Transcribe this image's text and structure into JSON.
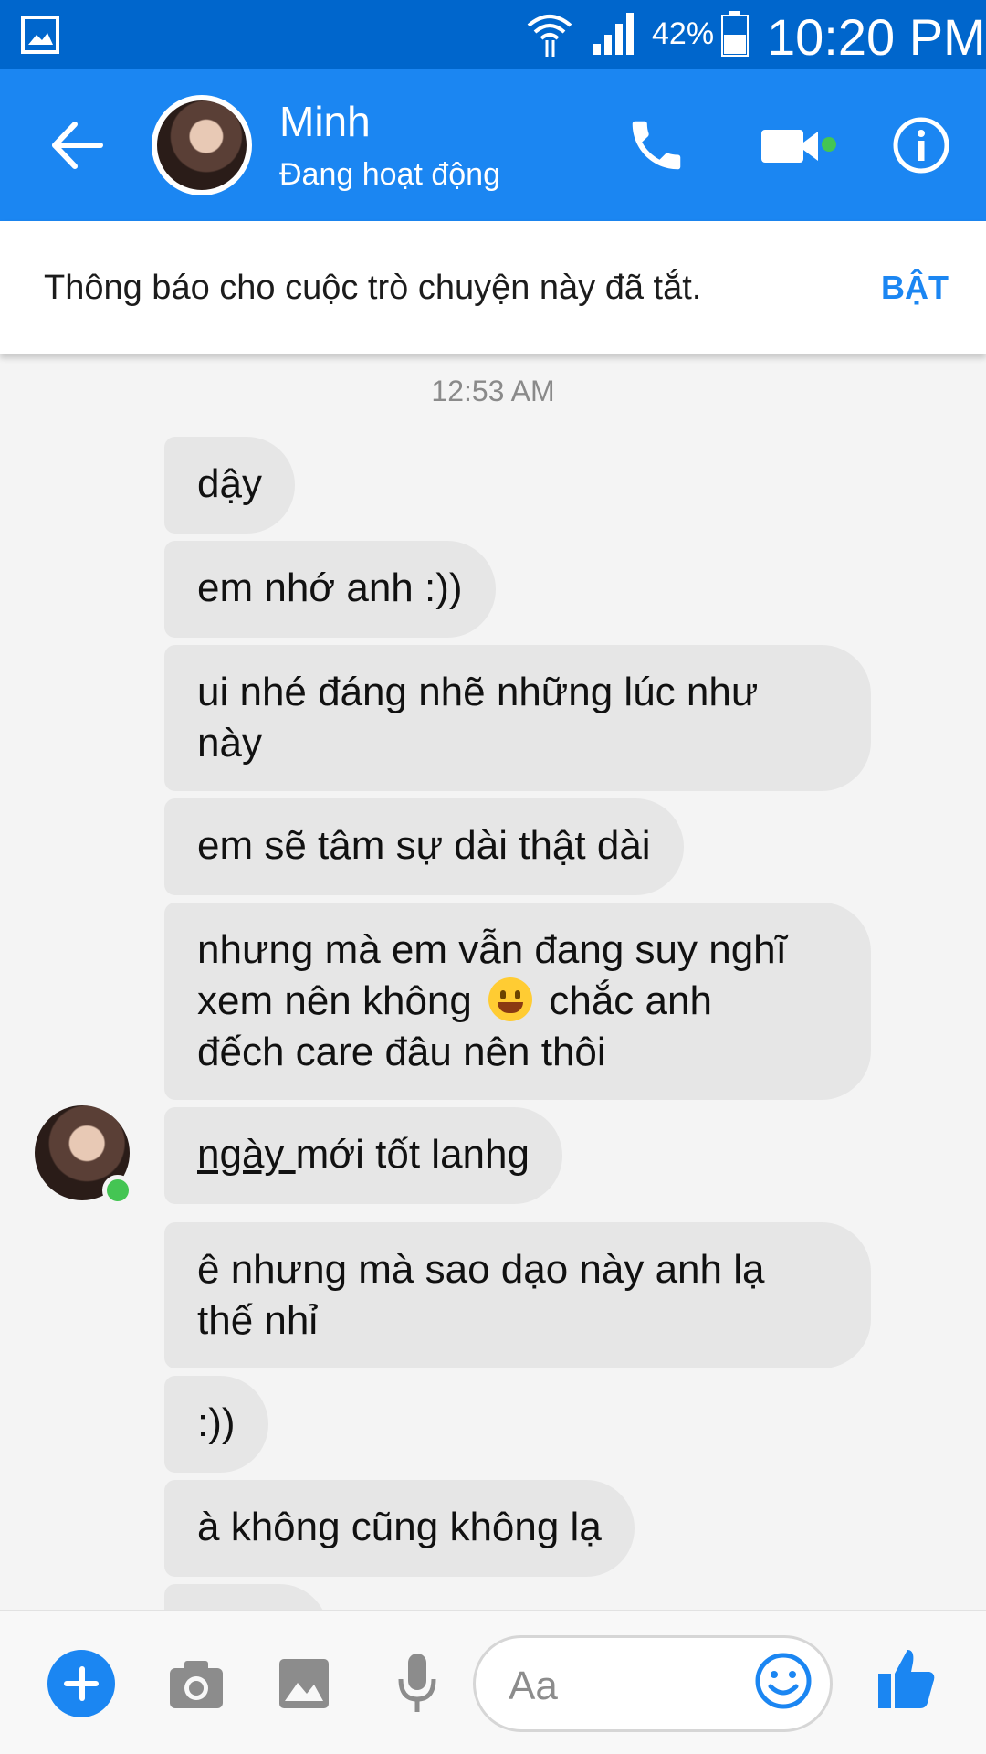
{
  "status_bar": {
    "battery_percent": "42%",
    "time": "10:20 PM",
    "icons": [
      "gallery-icon",
      "wifi-icon",
      "signal-icon",
      "battery-icon"
    ]
  },
  "header": {
    "contact_name": "Minh",
    "contact_status": "Đang hoạt động",
    "icons": [
      "back-arrow-icon",
      "phone-icon",
      "video-camera-icon",
      "info-icon"
    ]
  },
  "notice": {
    "text": "Thông báo cho cuộc trò chuyện này đã tắt.",
    "action_label": "BẬT"
  },
  "conversation": {
    "timestamp": "12:53 AM",
    "messages": [
      {
        "text": "dậy"
      },
      {
        "text": "em nhớ anh :))"
      },
      {
        "line1": "ui nhé đáng nhẽ những lúc như",
        "line2": "này"
      },
      {
        "text": "em sẽ tâm sự dài thật dài"
      },
      {
        "line1": "nhưng mà em vẫn đang suy nghĩ",
        "line2a": "xem nên không",
        "line2b": "chắc anh",
        "line3": "đếch care đâu nên thôi",
        "emoji": "grinning-face-emoji"
      },
      {
        "underlined": "ngày ",
        "rest": "mới tốt lanhg"
      },
      {
        "line1": "ê nhưng mà sao dạo này anh lạ",
        "line2": "thế nhỉ"
      },
      {
        "text": ":))"
      },
      {
        "text": "à không cũng không lạ"
      }
    ]
  },
  "composer": {
    "placeholder": "Aa",
    "icons": [
      "plus-icon",
      "camera-icon",
      "image-icon",
      "microphone-icon",
      "smiley-icon",
      "thumbs-up-icon"
    ]
  },
  "colors": {
    "status_bar": "#0066cc",
    "header": "#1b86f2",
    "accent": "#1b86f2",
    "bubble": "#e6e6e6",
    "online": "#44c553"
  }
}
